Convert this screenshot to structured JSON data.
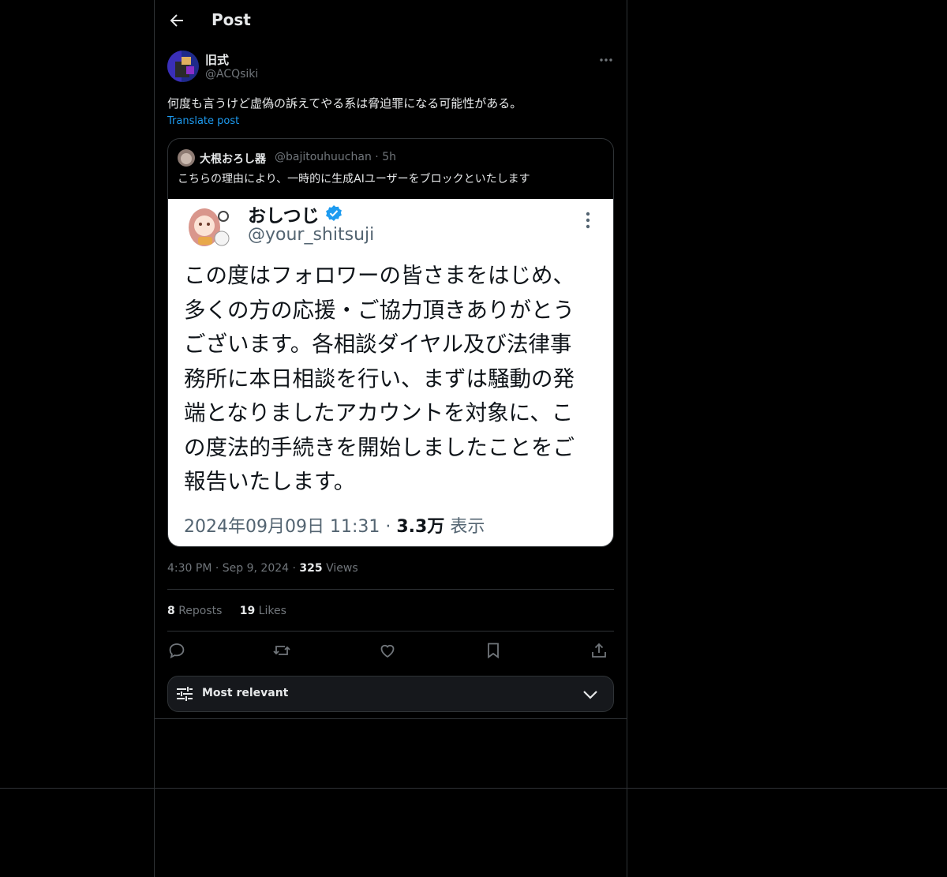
{
  "header": {
    "title": "Post"
  },
  "post": {
    "author_name": "旧式",
    "author_handle": "@ACQsiki",
    "text": "何度も言うけど虚偽の訴えてやる系は脅迫罪になる可能性がある。",
    "translate_label": "Translate post",
    "time": "4:30 PM",
    "date": "Sep 9, 2024",
    "views_count": "325",
    "views_label": "Views",
    "reposts_count": "8",
    "reposts_label": "Reposts",
    "likes_count": "19",
    "likes_label": "Likes"
  },
  "quote": {
    "author_name": "大根おろし器",
    "author_handle": "@bajitouhuuchan",
    "age": "5h",
    "text": "こちらの理由により、一時的に生成AIユーザーをブロックといたします",
    "screenshot": {
      "name": "おしつじ",
      "handle": "@your_shitsuji",
      "lines": [
        "この度はフォロワーの皆さまをはじめ、",
        "多くの方の応援・ご協力頂きありがとう",
        "ございます。各相談ダイヤル及び法律事",
        "務所に本日相談を行い、まずは騒動の発",
        "端となりましたアカウントを対象に、こ",
        "の度法的手続きを開始しましたことをご",
        "報告いたします。"
      ],
      "datetime": "2024年09月09日 11:31",
      "views_count": "3.3万",
      "views_label": "表示"
    }
  },
  "sort": {
    "label": "Most relevant"
  },
  "colors": {
    "accent": "#1d9bf0",
    "border": "#2f3336",
    "muted": "#71767b"
  },
  "icons": [
    "back-arrow-icon",
    "more-icon",
    "verified-icon",
    "reply-icon",
    "repost-icon",
    "like-icon",
    "bookmark-icon",
    "share-icon",
    "filter-icon",
    "chevron-down-icon"
  ]
}
